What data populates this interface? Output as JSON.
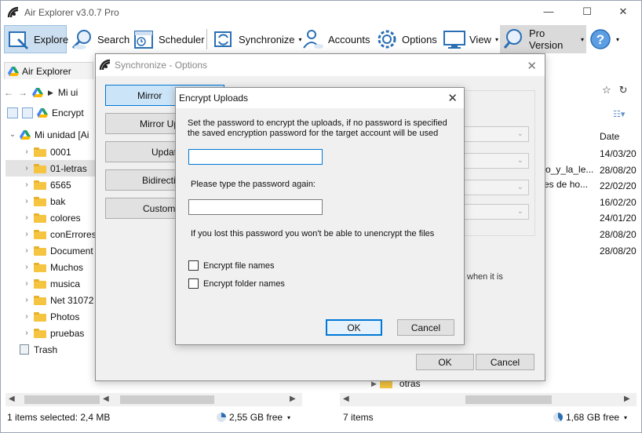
{
  "app": {
    "title": "Air Explorer v3.0.7 Pro",
    "window_controls": {
      "minimize": "—",
      "maximize": "☐",
      "close": "✕"
    }
  },
  "toolbar": {
    "explore": "Explore",
    "search": "Search",
    "scheduler": "Scheduler",
    "synchronize": "Synchronize",
    "accounts": "Accounts",
    "options": "Options",
    "view": "View",
    "pro_version": "Pro Version",
    "dropdown_glyph": "▾"
  },
  "left_pane": {
    "tab_label": "Air Explorer",
    "nav_path": "Mi ui",
    "encrypt_label": "Encrypt",
    "tree_root": "Mi unidad [Ai",
    "tree_items": [
      {
        "label": "0001"
      },
      {
        "label": "01-letras",
        "selected": true
      },
      {
        "label": "6565"
      },
      {
        "label": "bak"
      },
      {
        "label": "colores"
      },
      {
        "label": "conErrores"
      },
      {
        "label": "Document"
      },
      {
        "label": "Muchos"
      },
      {
        "label": "musica"
      },
      {
        "label": "Net 31072"
      },
      {
        "label": "Photos"
      },
      {
        "label": "pruebas"
      }
    ],
    "trash_label": "Trash",
    "status": "1 items selected: 2,4 MB",
    "free_space": "2,55 GB free"
  },
  "right_pane": {
    "date_header": "Date",
    "dates": [
      "14/03/20",
      "28/08/20",
      "22/02/20",
      "16/02/20",
      "24/01/20",
      "28/08/20",
      "28/08/20"
    ],
    "partial_names": [
      "ro_y_la_le...",
      "es de ho..."
    ],
    "partial_text": "when it is",
    "bottom_folder": "otras",
    "status": "7 items",
    "free_space": "1,68 GB free"
  },
  "sync_dialog": {
    "title": "Synchronize - Options",
    "side_buttons": [
      "Mirror",
      "Mirror Upd",
      "Update",
      "Bidirectio",
      "Customiz"
    ],
    "ok": "OK",
    "cancel": "Cancel"
  },
  "encrypt_dialog": {
    "title": "Encrypt Uploads",
    "instructions_line1": "Set the password to encrypt the uploads, if no password is specified",
    "instructions_line2": "the saved encryption password for the target account will be used",
    "password_value": "",
    "repeat_label": "Please type the password again:",
    "repeat_value": "",
    "warning": "If you lost this password you won't be able to unencrypt the files",
    "encrypt_file_names": "Encrypt file names",
    "encrypt_folder_names": "Encrypt folder names",
    "ok": "OK",
    "cancel": "Cancel"
  },
  "colors": {
    "accent": "#0078d7",
    "folder": "#f5c542",
    "dialog_bg": "#f0f0f0",
    "active_tool": "#ccdff0"
  }
}
